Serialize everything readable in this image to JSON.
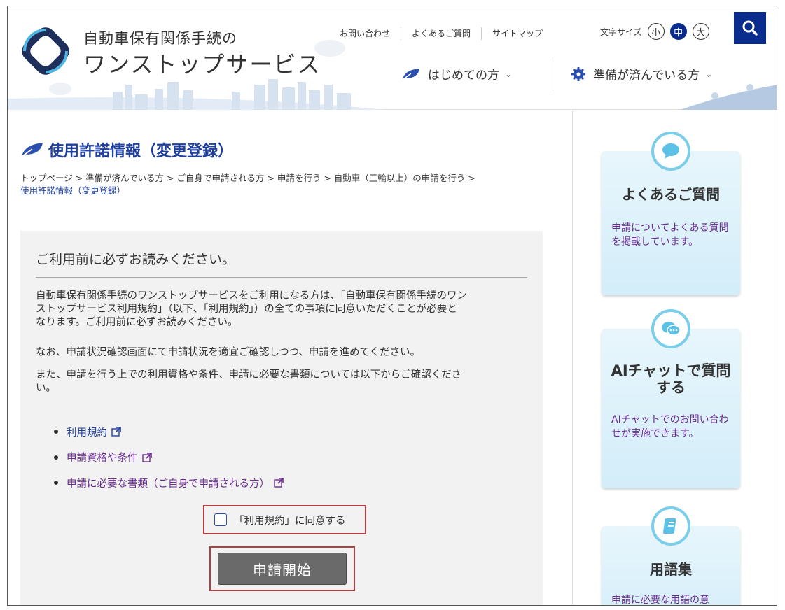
{
  "header": {
    "site_title_line1": "自動車保有関係手続の",
    "site_title_line2": "ワンストップサービス",
    "util_links": [
      "お問い合わせ",
      "よくあるご質問",
      "サイトマップ"
    ],
    "font_size_label": "文字サイズ",
    "font_sizes": [
      "小",
      "中",
      "大"
    ],
    "font_size_selected": "中",
    "nav_first": "はじめての方",
    "nav_ready": "準備が済んでいる方"
  },
  "page": {
    "title": "使用許諾情報（変更登録）",
    "breadcrumb_trail": "トップページ > 準備が済んでいる方 > ご自身で申請される方 > 申請を行う > 自動車（三輪以上）の申請を行う >",
    "breadcrumb_current": "使用許諾情報（変更登録）"
  },
  "notice": {
    "heading": "ご利用前に必ずお読みください。",
    "paragraph1_line1": "自動車保有関係手続のワンストップサービスをご利用になる方は、「自動車保有関係手続のワン",
    "paragraph1_line2": "ストップサービス利用規約」（以下、「利用規約」）の全ての事項に同意いただくことが必要と",
    "paragraph1_line3": "なります。ご利用前に必ずお読みください。",
    "paragraph2": "なお、申請状況確認画面にて申請状況を適宜ご確認しつつ、申請を進めてください。",
    "paragraph3_line1": "また、申請を行う上での利用資格や条件、申請に必要な書類については以下からご確認くださ",
    "paragraph3_line2": "い。",
    "links": [
      "利用規約",
      "申請資格や条件",
      "申請に必要な書類（ご自身で申請される方）"
    ],
    "agree_label": "「利用規約」に同意する",
    "agree_checked": false,
    "start_button": "申請開始"
  },
  "sidebar": {
    "cards": [
      {
        "title": "よくあるご質問",
        "desc": "申請についてよくある質問を掲載しています。",
        "icon": "speech-bubble-icon"
      },
      {
        "title_line1": "AIチャットで質問",
        "title_line2": "する",
        "desc": "AIチャットでのお問い合わせが実施できます。",
        "icon": "chat-bubbles-icon"
      },
      {
        "title": "用語集",
        "desc": "申請に必要な用語の意",
        "icon": "book-icon"
      }
    ]
  },
  "colors": {
    "brand_navy": "#0a2c8c",
    "title_blue": "#1f3f9c",
    "link_purple": "#6b2c91",
    "highlight_red": "#b04040",
    "card_blue": "#d3edf9"
  }
}
